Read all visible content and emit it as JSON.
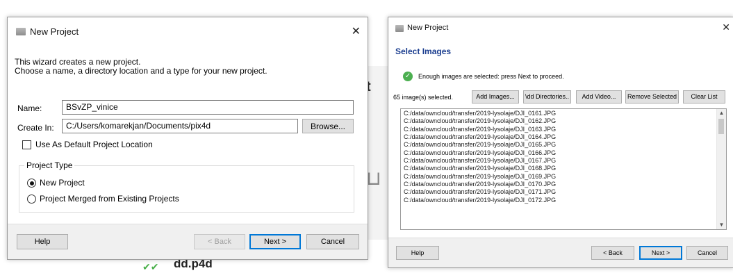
{
  "background": {
    "partial_heading": "t",
    "partial_file_label": "dd.p4d"
  },
  "dialog1": {
    "title": "New Project",
    "description_line1": "This wizard creates a new project.",
    "description_line2": "Choose a name, a directory location and a type for your new project.",
    "name_label": "Name:",
    "name_value": "BSvZP_vinice",
    "create_in_label": "Create In:",
    "create_in_value": "C:/Users/komarekjan/Documents/pix4d",
    "browse_label": "Browse...",
    "default_location_label": "Use As Default Project Location",
    "default_location_checked": false,
    "project_type_label": "Project Type",
    "project_type_options": [
      "New Project",
      "Project Merged from Existing Projects"
    ],
    "project_type_selected": "New Project",
    "help_label": "Help",
    "back_label": "< Back",
    "next_label": "Next >",
    "cancel_label": "Cancel"
  },
  "dialog2": {
    "title": "New Project",
    "heading": "Select Images",
    "status_text": "Enough images are selected: press Next to proceed.",
    "selected_count": "65 image(s) selected.",
    "add_images_label": "Add Images...",
    "add_directories_label": "\\dd Directories..",
    "add_video_label": "Add Video...",
    "remove_selected_label": "Remove Selected",
    "clear_list_label": "Clear List",
    "files": [
      "C:/data/owncloud/transfer/2019-lysolaje/DJI_0161.JPG",
      "C:/data/owncloud/transfer/2019-lysolaje/DJI_0162.JPG",
      "C:/data/owncloud/transfer/2019-lysolaje/DJI_0163.JPG",
      "C:/data/owncloud/transfer/2019-lysolaje/DJI_0164.JPG",
      "C:/data/owncloud/transfer/2019-lysolaje/DJI_0165.JPG",
      "C:/data/owncloud/transfer/2019-lysolaje/DJI_0166.JPG",
      "C:/data/owncloud/transfer/2019-lysolaje/DJI_0167.JPG",
      "C:/data/owncloud/transfer/2019-lysolaje/DJI_0168.JPG",
      "C:/data/owncloud/transfer/2019-lysolaje/DJI_0169.JPG",
      "C:/data/owncloud/transfer/2019-lysolaje/DJI_0170.JPG",
      "C:/data/owncloud/transfer/2019-lysolaje/DJI_0171.JPG",
      "C:/data/owncloud/transfer/2019-lysolaje/DJI_0172.JPG"
    ],
    "help_label": "Help",
    "back_label": "< Back",
    "next_label": "Next >",
    "cancel_label": "Cancel"
  },
  "colors": {
    "accent": "#0078d7",
    "heading_blue": "#1a3d8f",
    "success_green": "#4caf50"
  },
  "icons": {
    "close": "close-icon",
    "app": "pix4d-app-icon",
    "status": "check-circle-icon"
  }
}
